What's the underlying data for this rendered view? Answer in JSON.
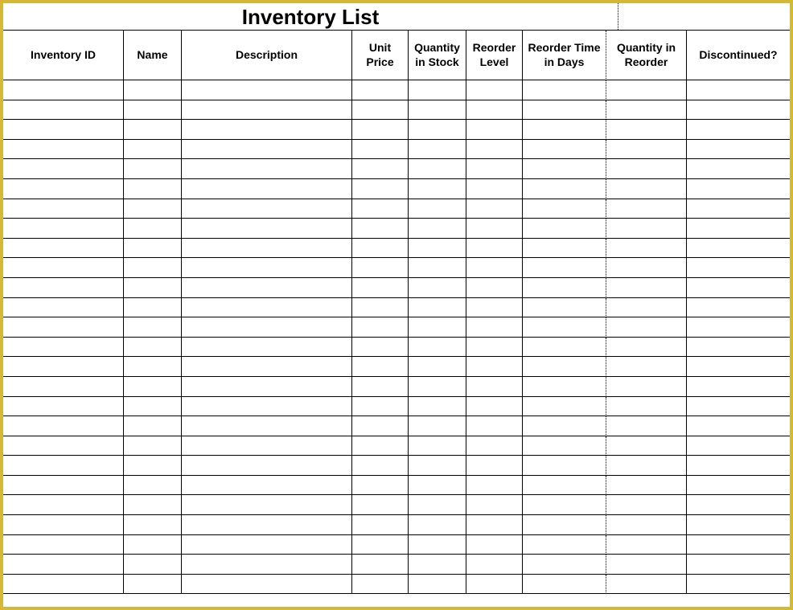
{
  "title": "Inventory List",
  "columns": [
    "Inventory ID",
    "Name",
    "Description",
    "Unit Price",
    "Quantity in Stock",
    "Reorder Level",
    "Reorder Time in Days",
    "Quantity in Reorder",
    "Discontinued?"
  ],
  "row_count": 26,
  "rows": []
}
